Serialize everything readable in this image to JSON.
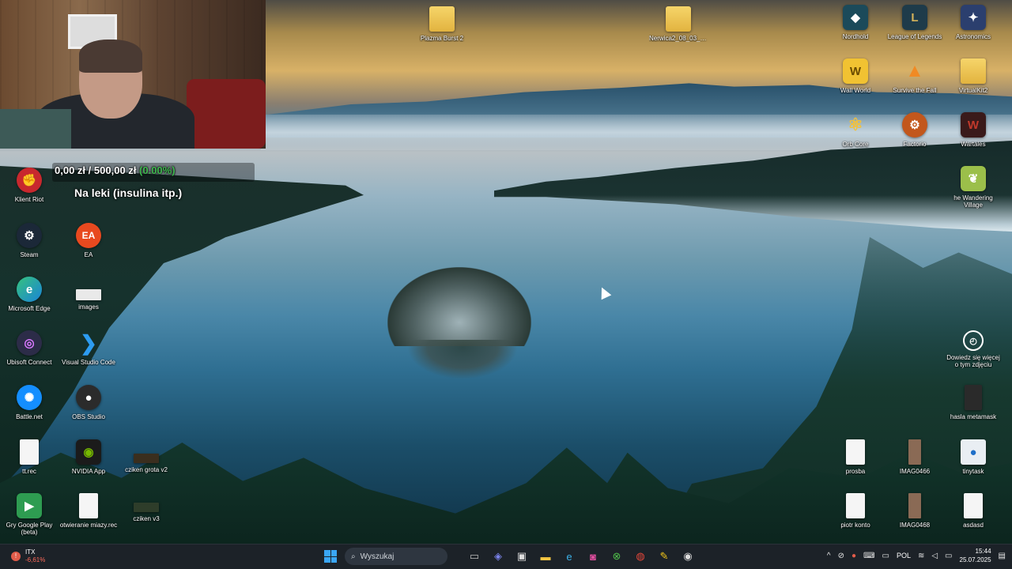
{
  "webcam": {
    "present": true
  },
  "donation": {
    "current": "0,00 zł",
    "separator": "/",
    "goal": "500,00 zł",
    "percent": "(0.00%)",
    "progress": 0.0,
    "caption": "Na leki (insulina itp.)"
  },
  "desktop_icons": {
    "plazma_burst": {
      "label": "Plazma Burst 2",
      "icon": "folder-icon"
    },
    "nerwica": {
      "label": "Nerwica2_08_03_2025",
      "icon": "folder-icon"
    },
    "nordhold": {
      "label": "Nordhold",
      "icon": "nordhold-icon"
    },
    "league": {
      "label": "League of Legends",
      "icon": "league-icon"
    },
    "astronomics": {
      "label": "Astronomics",
      "icon": "astronomics-icon"
    },
    "wall_world": {
      "label": "Wall World",
      "icon": "wall-world-icon"
    },
    "survive": {
      "label": "Survive the Fall",
      "icon": "survive-icon"
    },
    "virtualkit": {
      "label": "VirtualKit2",
      "icon": "folder-icon"
    },
    "orb": {
      "label": "Orb Core",
      "icon": "orb-icon"
    },
    "factorio": {
      "label": "Factorio",
      "icon": "factorio-icon"
    },
    "wartales": {
      "label": "Wartales",
      "icon": "wartales-icon"
    },
    "wandering": {
      "label": "he Wandering Village",
      "icon": "wandering-village-icon"
    },
    "klient_riot": {
      "label": "Klient Riot",
      "icon": "riot-icon"
    },
    "steam": {
      "label": "Steam",
      "icon": "steam-icon"
    },
    "ea": {
      "label": "EA",
      "icon": "ea-icon"
    },
    "edge": {
      "label": "Microsoft Edge",
      "icon": "edge-icon"
    },
    "images": {
      "label": "images",
      "icon": "image-file-icon"
    },
    "ubisoft": {
      "label": "Ubisoft Connect",
      "icon": "ubisoft-icon"
    },
    "vscode": {
      "label": "Visual Studio Code",
      "icon": "vscode-icon"
    },
    "battlenet": {
      "label": "Battle.net",
      "icon": "battlenet-icon"
    },
    "obs": {
      "label": "OBS Studio",
      "icon": "obs-icon"
    },
    "tt": {
      "label": "tt.rec",
      "icon": "document-icon"
    },
    "nvidia": {
      "label": "NVIDIA App",
      "icon": "nvidia-icon"
    },
    "cziken_grota": {
      "label": "cziken grota v2",
      "icon": "image-file-icon"
    },
    "gry_google": {
      "label": "Gry Google Play (beta)",
      "icon": "google-play-games-icon"
    },
    "otwieranie": {
      "label": "otwieranie miazy.rec",
      "icon": "document-icon"
    },
    "cziken_v3": {
      "label": "cziken v3",
      "icon": "image-file-icon"
    },
    "dowiedz": {
      "label": "Dowiedz się więcej o tym zdjęciu",
      "icon": "camera-icon"
    },
    "hasla": {
      "label": "hasla metamask",
      "icon": "document-icon"
    },
    "prosba": {
      "label": "prosba",
      "icon": "document-icon"
    },
    "imag1": {
      "label": "IMAG0466",
      "icon": "image-file-icon"
    },
    "tinytask": {
      "label": "tinytask",
      "icon": "tinytask-icon"
    },
    "piotr": {
      "label": "piotr konto",
      "icon": "document-icon"
    },
    "imag2": {
      "label": "IMAG0468",
      "icon": "image-file-icon"
    },
    "asdasd": {
      "label": "asdasd",
      "icon": "document-icon"
    }
  },
  "taskbar": {
    "weather": {
      "name": "ITX",
      "change": "-6,61%"
    },
    "search_placeholder": "Wyszukaj",
    "apps": [
      "task-view-icon",
      "teams-icon",
      "store-icon",
      "file-explorer-icon",
      "edge-icon",
      "instagram-icon",
      "xbox-icon",
      "chrome-icon",
      "app-icon",
      "obs-icon"
    ],
    "language": "POL",
    "time": "15:44",
    "date": "25.07.2025"
  }
}
